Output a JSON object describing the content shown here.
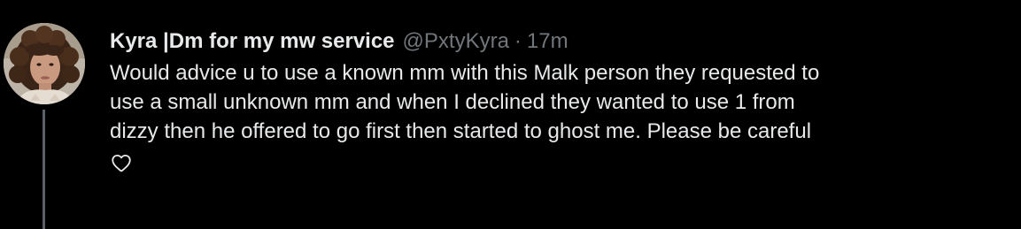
{
  "tweet": {
    "display_name": "Kyra |Dm for my mw service",
    "handle": "@PxtyKyra",
    "separator": "·",
    "time": "17m",
    "lines": [
      "Would advice u to use a known mm with this Malk person they requested to",
      "use a small unknown mm and when I declined they wanted to use 1 from",
      "dizzy then he offered to go first then started to ghost me. Please be careful"
    ]
  },
  "icons": {
    "like": "heart-outline-icon",
    "avatar": "profile-photo"
  },
  "colors": {
    "background": "#000000",
    "primary_text": "#e7e9ea",
    "secondary_text": "#71767b",
    "thread_line": "#5b6167"
  }
}
